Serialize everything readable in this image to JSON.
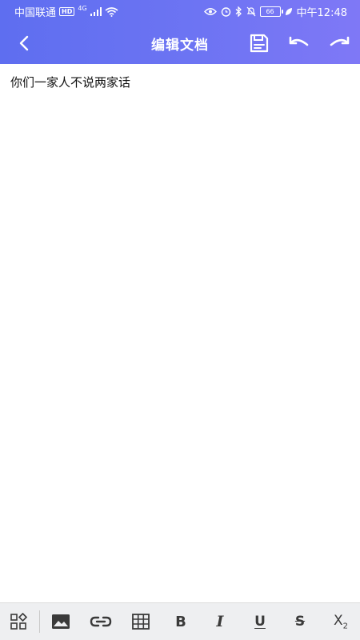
{
  "status_bar": {
    "carrier": "中国联通",
    "hd_badge": "HD",
    "network": "4G",
    "battery": "66",
    "time": "中午12:48"
  },
  "header": {
    "title": "编辑文档",
    "gradient_start": "#5e6ef0",
    "gradient_end": "#7f78f6"
  },
  "document": {
    "text": "你们一家人不说两家话"
  },
  "editor_toolbar": {
    "bold": "B",
    "italic": "I",
    "underline": "U",
    "strikethrough": "S",
    "subscript_base": "X",
    "subscript_index": "2"
  }
}
